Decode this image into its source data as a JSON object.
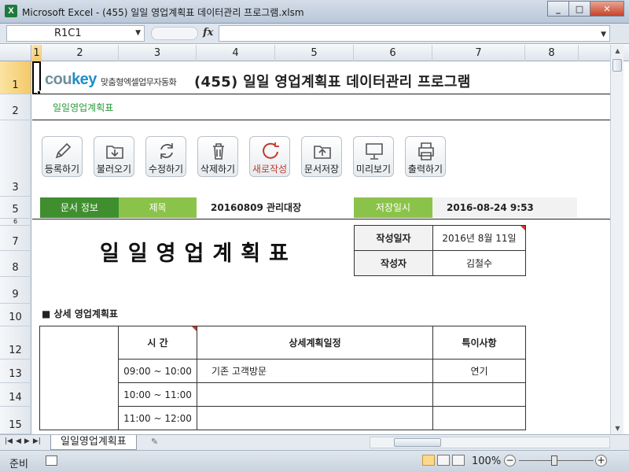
{
  "window": {
    "title": "Microsoft Excel - (455) 일일 영업계획표 데이터관리 프로그램.xlsm",
    "app_icon": "X"
  },
  "formula_bar": {
    "name_box": "R1C1",
    "fx_label": "fx",
    "formula": ""
  },
  "columns": [
    "1",
    "2",
    "3",
    "4",
    "5",
    "6",
    "7",
    "8"
  ],
  "rows": [
    "1",
    "2",
    "3",
    "5",
    "6",
    "7",
    "8",
    "9",
    "10",
    "12",
    "13",
    "14",
    "15"
  ],
  "sheet": {
    "logo_text": "coukey",
    "logo_sub": "맞춤형엑셀업무자동화",
    "title": "(455) 일일 영업계획표 데이터관리 프로그램",
    "subtitle": "일일영업계획표",
    "buttons": [
      {
        "label": "등록하기",
        "icon": "pencil-icon"
      },
      {
        "label": "불러오기",
        "icon": "folder-download-icon"
      },
      {
        "label": "수정하기",
        "icon": "refresh-icon"
      },
      {
        "label": "삭제하기",
        "icon": "trash-icon"
      },
      {
        "label": "새로작성",
        "icon": "new-circle-icon"
      },
      {
        "label": "문서저장",
        "icon": "folder-upload-icon"
      },
      {
        "label": "미리보기",
        "icon": "monitor-icon"
      },
      {
        "label": "출력하기",
        "icon": "printer-icon"
      }
    ],
    "info": {
      "doc_info_label": "문서 정보",
      "title_label": "제목",
      "title_value": "20160809 관리대장",
      "saved_label": "저장일시",
      "saved_value": "2016-08-24 9:53"
    },
    "big_title": "일일영업계획표",
    "meta": {
      "date_label": "작성일자",
      "date_value": "2016년 8월 11일",
      "author_label": "작성자",
      "author_value": "김철수"
    },
    "section_title": "■ 상세 영업계획표",
    "plan_headers": [
      "시  간",
      "상세계획일정",
      "특이사항"
    ],
    "plan_rows": [
      {
        "time": "09:00 ~ 10:00",
        "detail": "기존 고객방문",
        "note": "연기"
      },
      {
        "time": "10:00 ~ 11:00",
        "detail": "",
        "note": ""
      },
      {
        "time": "11:00 ~ 12:00",
        "detail": "",
        "note": ""
      }
    ]
  },
  "sheet_tabs": [
    "일일영업계획표"
  ],
  "status": {
    "ready": "준비",
    "zoom": "100%"
  }
}
